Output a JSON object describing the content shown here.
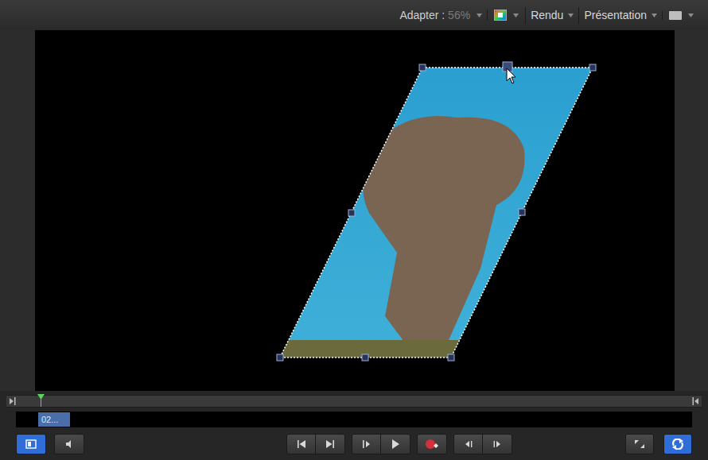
{
  "toolbar": {
    "fit": {
      "label": "Adapter :",
      "value": "56%"
    },
    "render": "Rendu",
    "view": "Présentation"
  },
  "canvas": {
    "layer": {
      "selected": true,
      "handle_hovered": true
    }
  },
  "timeline": {
    "playhead": {
      "level": 0.004
    }
  },
  "mini_timeline": {
    "clip": {
      "label": "02...",
      "selected": true
    }
  },
  "transport": {
    "left": [
      {
        "kind": "layers",
        "on": true
      },
      {
        "kind": "audio",
        "on": false
      }
    ],
    "center": [
      [
        {
          "kind": "go-start",
          "on": false
        },
        {
          "kind": "go-end",
          "on": false
        }
      ],
      [
        {
          "kind": "step-frame",
          "on": false
        },
        {
          "kind": "play",
          "on": false
        }
      ],
      [
        {
          "kind": "record",
          "on": false
        }
      ],
      [
        {
          "kind": "prev-key",
          "on": false
        },
        {
          "kind": "next-key",
          "on": false
        }
      ]
    ],
    "right": [
      {
        "kind": "fullscreen",
        "on": false
      },
      {
        "kind": "loop",
        "on": true
      }
    ]
  }
}
